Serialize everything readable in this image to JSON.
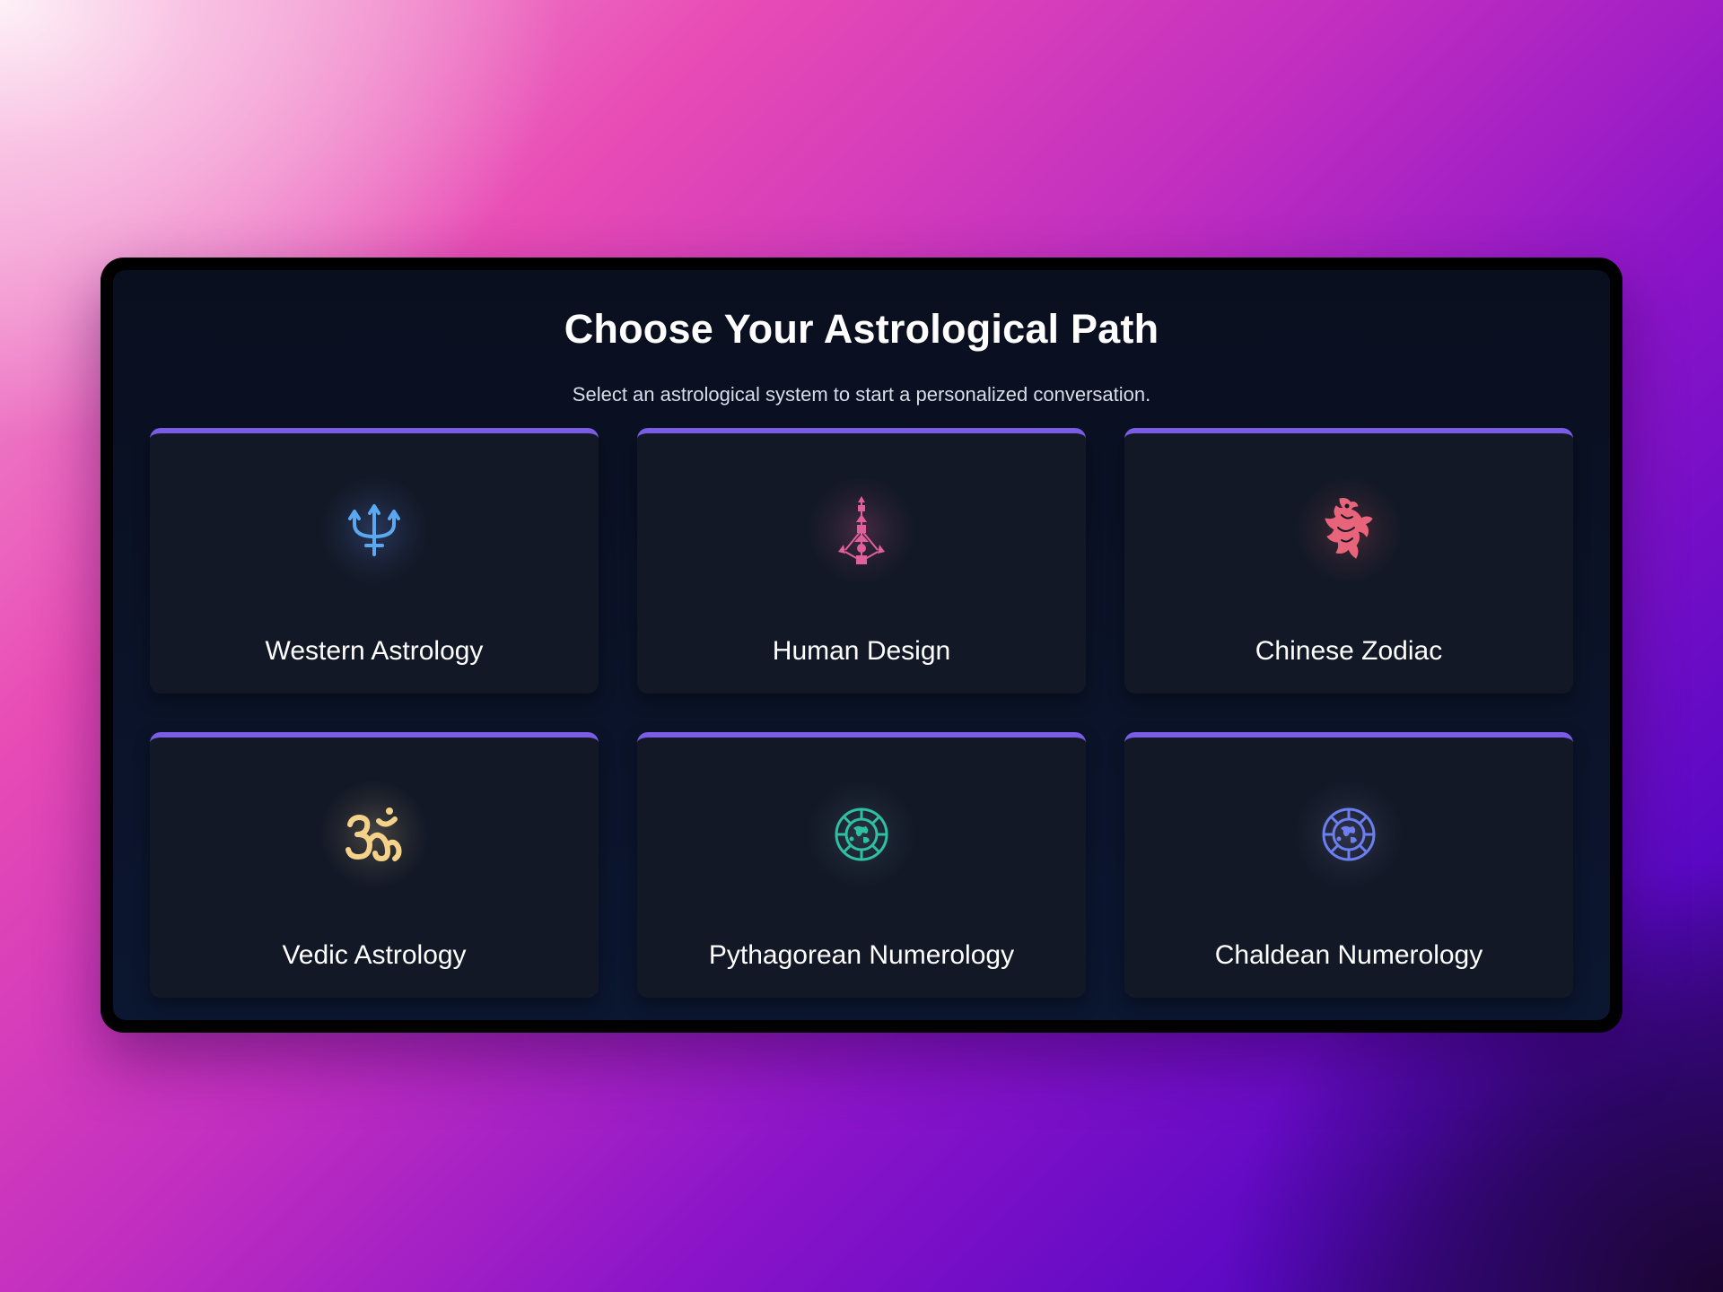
{
  "header": {
    "title": "Choose Your Astrological Path",
    "subtitle": "Select an astrological system to start a personalized conversation."
  },
  "colors": {
    "card_accent": "#7b5ce6",
    "card_background": "#121826",
    "panel_background": "#0a0f1f"
  },
  "cards": [
    {
      "label": "Western Astrology",
      "icon": "trident-icon",
      "icon_color": "#5aa8f0"
    },
    {
      "label": "Human Design",
      "icon": "bodygraph-icon",
      "icon_color": "#e0609a"
    },
    {
      "label": "Chinese Zodiac",
      "icon": "dragon-icon",
      "icon_color": "#e8647a"
    },
    {
      "label": "Vedic Astrology",
      "icon": "om-icon",
      "icon_color": "#f4d28a"
    },
    {
      "label": "Pythagorean Numerology",
      "icon": "globe-compass-icon",
      "icon_color": "#2fc0a0"
    },
    {
      "label": "Chaldean Numerology",
      "icon": "globe-compass-icon",
      "icon_color": "#6c7ff0"
    }
  ]
}
